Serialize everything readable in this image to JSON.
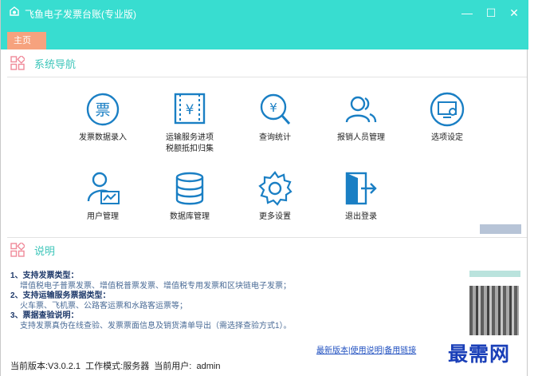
{
  "window": {
    "title": "飞鱼电子发票台账(专业版)"
  },
  "tabs": [
    {
      "label": "主页"
    }
  ],
  "nav_section": {
    "title": "系统导航",
    "items": [
      {
        "label": "发票数据录入",
        "icon": "invoice-entry-icon"
      },
      {
        "label": "运输服务进项\n税额抵扣归集",
        "icon": "transport-tax-icon"
      },
      {
        "label": "查询统计",
        "icon": "search-stats-icon"
      },
      {
        "label": "报销人员管理",
        "icon": "staff-management-icon"
      },
      {
        "label": "选项设定",
        "icon": "settings-screen-icon"
      },
      {
        "label": "用户管理",
        "icon": "user-management-icon"
      },
      {
        "label": "数据库管理",
        "icon": "database-icon"
      },
      {
        "label": "更多设置",
        "icon": "gear-icon"
      },
      {
        "label": "退出登录",
        "icon": "logout-icon"
      }
    ]
  },
  "info_section": {
    "title": "说明",
    "lines": [
      {
        "type": "h",
        "text": "1、支持发票类型："
      },
      {
        "type": "b",
        "text": "增值税电子普票发票、增值税普票发票、增值税专用发票和区块链电子发票；"
      },
      {
        "type": "h",
        "text": "2、支持运输服务票据类型："
      },
      {
        "type": "b",
        "text": "火车票、飞机票、公路客运票和水路客运票等；"
      },
      {
        "type": "h",
        "text": "3、票据查验说明："
      },
      {
        "type": "b",
        "text": "支持发票真伪在线查验、发票票面信息及销货清单导出（需选择查验方式1）。"
      }
    ]
  },
  "links": {
    "latest": "最新版本",
    "help": "使用说明",
    "backup": "备用链接",
    "sep": "|"
  },
  "status": {
    "text": "当前版本:V3.0.2.1  工作模式:服务器  当前用户:  admin"
  },
  "watermark": "最需网",
  "colors": {
    "titlebar": "#38ddd0",
    "tab": "#f6a27e",
    "accent": "#3ec6ba",
    "icon": "#1a7fc4",
    "link": "#2050c0"
  }
}
